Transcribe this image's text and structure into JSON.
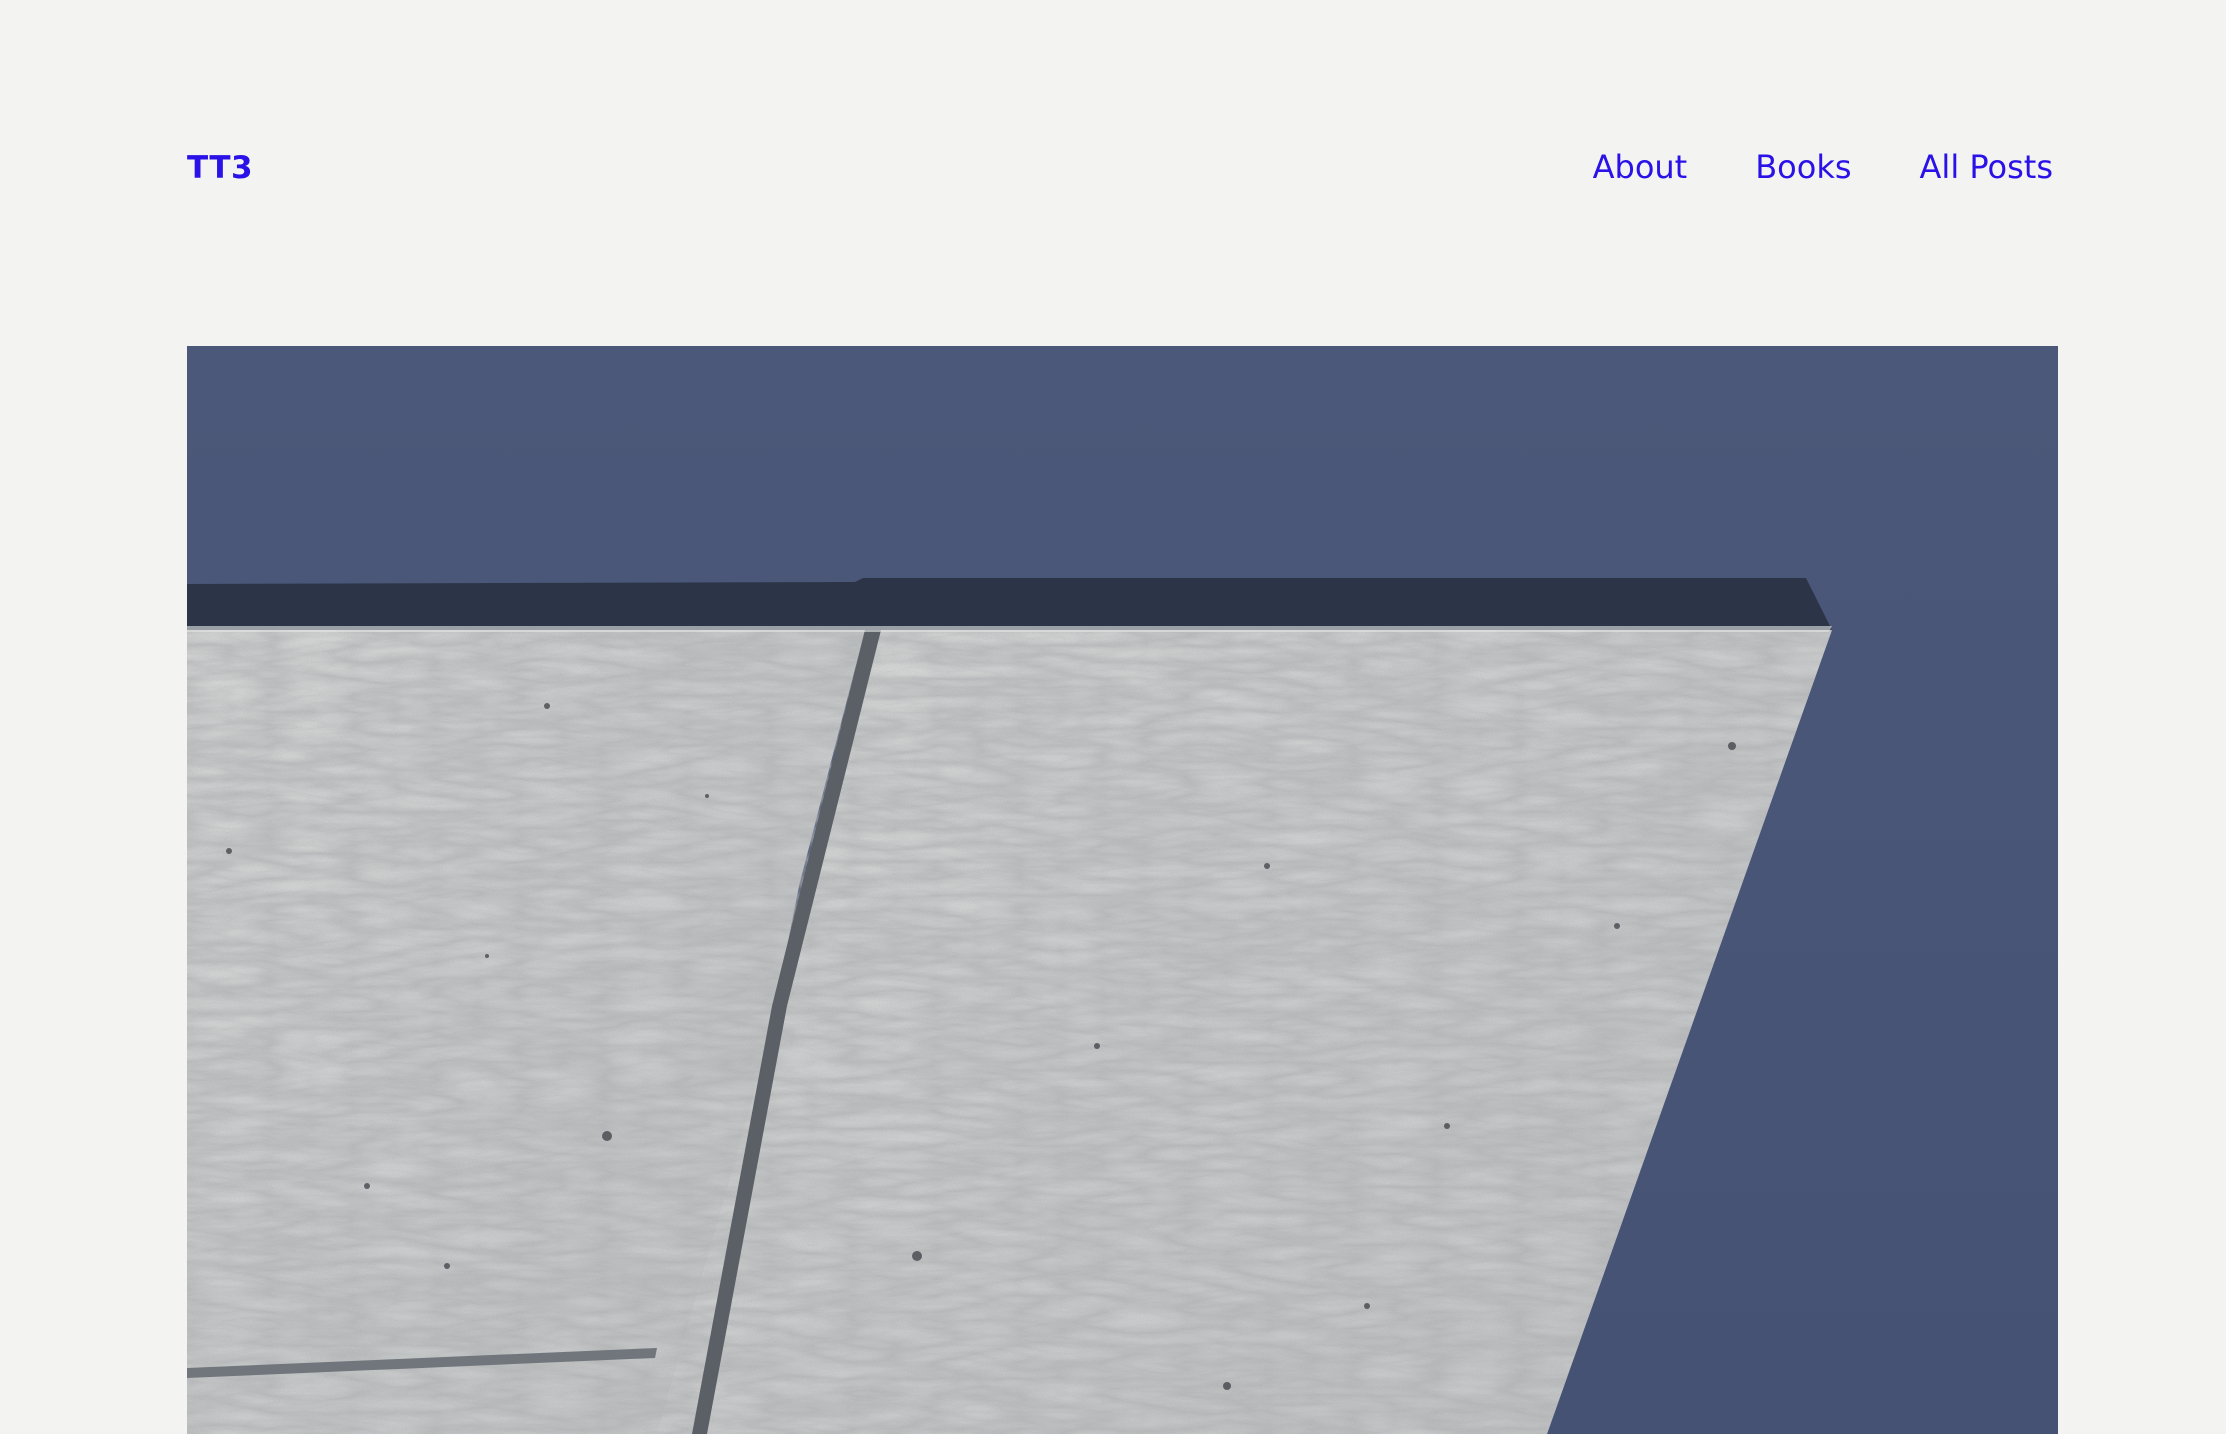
{
  "header": {
    "site_title": "TT3",
    "nav": [
      {
        "label": "About"
      },
      {
        "label": "Books"
      },
      {
        "label": "All Posts"
      }
    ]
  },
  "hero_image": {
    "subject": "concrete-structure-against-blue-sky",
    "colors": {
      "sky": "#4a5678",
      "concrete": "#d6d7d7",
      "shadow": "#2c3547",
      "link": "#2a11e8",
      "background": "#f3f3f1"
    }
  }
}
